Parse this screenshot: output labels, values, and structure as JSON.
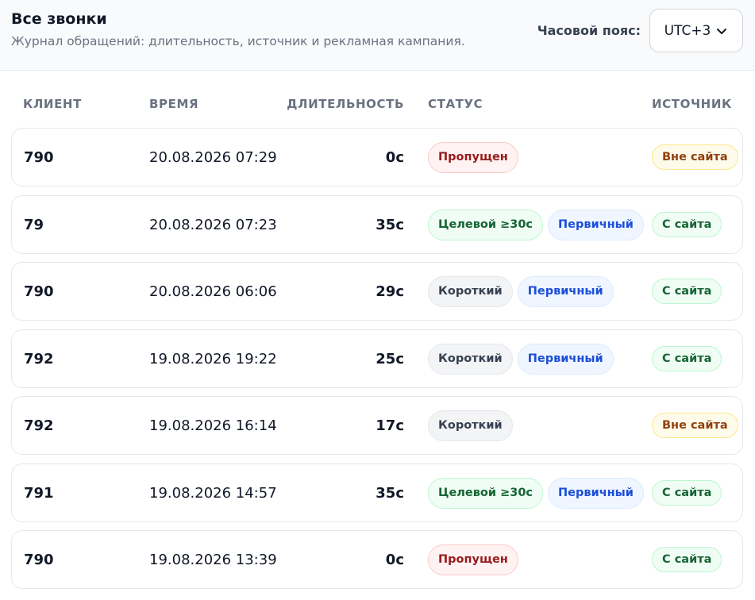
{
  "header": {
    "title": "Все звонки",
    "subtitle": "Журнал обращений: длительность, источник и рекламная кампания.",
    "timezone_label": "Часовой пояс:",
    "timezone_value": "UTC+3"
  },
  "columns": {
    "client": "КЛИЕНТ",
    "time": "ВРЕМЯ",
    "duration": "ДЛИТЕЛЬНОСТЬ",
    "status": "СТАТУС",
    "source": "ИСТОЧНИК"
  },
  "rows": [
    {
      "client": "790",
      "time": "20.08.2026 07:29",
      "duration": "0с",
      "statuses": [
        {
          "label": "Пропущен",
          "kind": "missed"
        }
      ],
      "source": {
        "label": "Вне сайта",
        "kind": "offsite"
      }
    },
    {
      "client": "79",
      "time": "20.08.2026 07:23",
      "duration": "35с",
      "statuses": [
        {
          "label": "Целевой ≥30с",
          "kind": "target"
        },
        {
          "label": "Первичный",
          "kind": "primary"
        }
      ],
      "source": {
        "label": "С сайта",
        "kind": "site"
      }
    },
    {
      "client": "790",
      "time": "20.08.2026 06:06",
      "duration": "29с",
      "statuses": [
        {
          "label": "Короткий",
          "kind": "short"
        },
        {
          "label": "Первичный",
          "kind": "primary"
        }
      ],
      "source": {
        "label": "С сайта",
        "kind": "site"
      }
    },
    {
      "client": "792",
      "time": "19.08.2026 19:22",
      "duration": "25с",
      "statuses": [
        {
          "label": "Короткий",
          "kind": "short"
        },
        {
          "label": "Первичный",
          "kind": "primary"
        }
      ],
      "source": {
        "label": "С сайта",
        "kind": "site"
      }
    },
    {
      "client": "792",
      "time": "19.08.2026 16:14",
      "duration": "17с",
      "statuses": [
        {
          "label": "Короткий",
          "kind": "short"
        }
      ],
      "source": {
        "label": "Вне сайта",
        "kind": "offsite"
      }
    },
    {
      "client": "791",
      "time": "19.08.2026 14:57",
      "duration": "35с",
      "statuses": [
        {
          "label": "Целевой ≥30с",
          "kind": "target"
        },
        {
          "label": "Первичный",
          "kind": "primary"
        }
      ],
      "source": {
        "label": "С сайта",
        "kind": "site"
      }
    },
    {
      "client": "790",
      "time": "19.08.2026 13:39",
      "duration": "0с",
      "statuses": [
        {
          "label": "Пропущен",
          "kind": "missed"
        }
      ],
      "source": {
        "label": "С сайта",
        "kind": "site"
      }
    }
  ],
  "icons": {
    "timezone_dropdown": "chevron-down-icon"
  }
}
